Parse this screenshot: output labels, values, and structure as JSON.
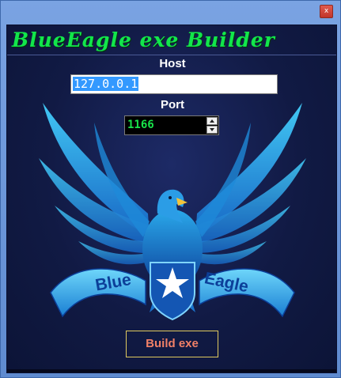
{
  "window": {
    "close_glyph": "x",
    "close_icon": "close-icon"
  },
  "panel": {
    "title": "BlueEagle exe Builder",
    "host_label": "Host",
    "host_value": "127.0.0.1",
    "port_label": "Port",
    "port_value": "1166",
    "build_label": "Build exe"
  },
  "logo": {
    "left_text": "Blue",
    "right_text": "Eagle"
  },
  "colors": {
    "title_green": "#12e64b",
    "panel_bg": "#111a44",
    "button_text": "#f08067",
    "button_border": "#e0c95e"
  }
}
